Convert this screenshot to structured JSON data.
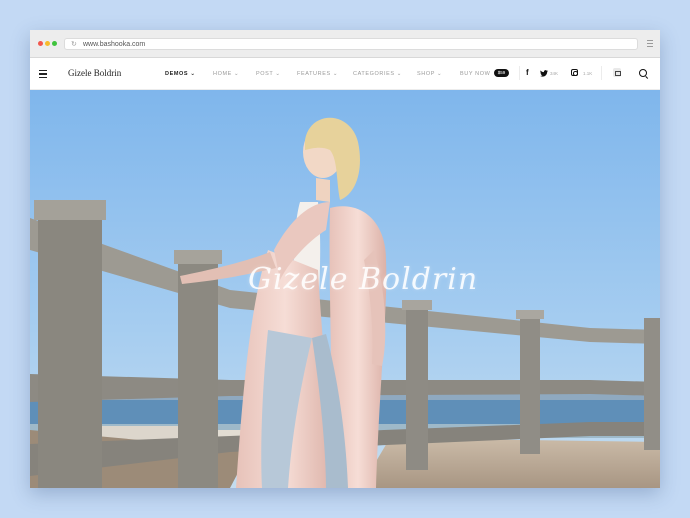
{
  "browser": {
    "url": "www.bashooka.com",
    "reload_icon": "↻"
  },
  "site": {
    "logo": "Gizele Boldrin"
  },
  "nav": {
    "items": [
      {
        "label": "DEMOS",
        "chevron": "⌄",
        "active": true
      },
      {
        "label": "HOME",
        "chevron": "⌄"
      },
      {
        "label": "POST",
        "chevron": "⌄"
      },
      {
        "label": "FEATURES",
        "chevron": "⌄"
      },
      {
        "label": "CATEGORIES",
        "chevron": "⌄"
      },
      {
        "label": "SHOP",
        "chevron": "⌄"
      },
      {
        "label": "BUY NOW"
      }
    ],
    "buy_badge": "$59"
  },
  "social": {
    "facebook_icon": "f",
    "twitter_count": "34K",
    "instagram_count": "1.1K"
  },
  "hero": {
    "title": "Gizele Boldrin"
  },
  "colors": {
    "page_bg": "#c3d9f4",
    "sky_top": "#7fb6ec",
    "sea": "#5f8fb8",
    "coat": "#f0d0c8"
  }
}
